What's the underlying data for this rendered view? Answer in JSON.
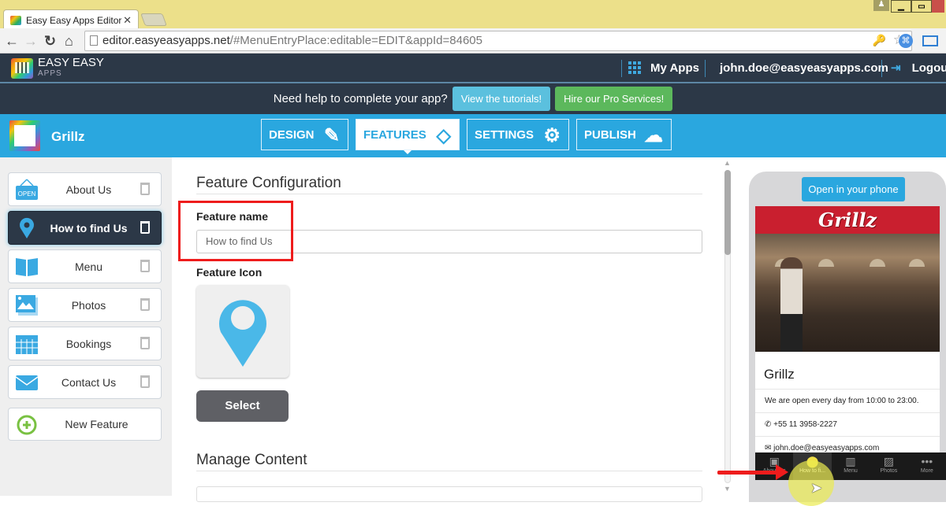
{
  "browser": {
    "tab_title": "Easy Easy Apps Editor",
    "url_host": "editor.easyeasyapps.net",
    "url_path": "/#MenuEntryPlace:editable=EDIT&appId=84605"
  },
  "header": {
    "logo_line1": "EASY EASY",
    "logo_line2": "APPS",
    "my_apps": "My Apps",
    "user_email": "john.doe@easyeasyapps.com",
    "logout": "Logout"
  },
  "help_bar": {
    "text": "Need help to complete your app?",
    "tutorials_button": "View the tutorials!",
    "pro_button": "Hire our Pro Services!",
    "tutorials_color": "#5bc0de",
    "pro_color": "#5cb85c"
  },
  "app": {
    "name": "Grillz"
  },
  "main_tabs": [
    {
      "label": "DESIGN",
      "icon": "brush-icon",
      "glyph": "🖌"
    },
    {
      "label": "FEATURES",
      "icon": "tags-icon",
      "glyph": "◇",
      "active": true
    },
    {
      "label": "SETTINGS",
      "icon": "gear-icon",
      "glyph": "⚙"
    },
    {
      "label": "PUBLISH",
      "icon": "cloud-upload-icon",
      "glyph": "☁"
    }
  ],
  "sidebar": {
    "items": [
      {
        "label": "About Us",
        "icon": "open-sign-icon"
      },
      {
        "label": "How to find Us",
        "icon": "map-pin-icon",
        "active": true
      },
      {
        "label": "Menu",
        "icon": "book-icon"
      },
      {
        "label": "Photos",
        "icon": "photos-icon"
      },
      {
        "label": "Bookings",
        "icon": "calendar-icon"
      },
      {
        "label": "Contact Us",
        "icon": "envelope-icon"
      }
    ],
    "new_feature": "New Feature"
  },
  "config": {
    "title": "Feature Configuration",
    "name_label": "Feature name",
    "name_value": "How to find Us",
    "icon_label": "Feature Icon",
    "select_button": "Select",
    "manage_title": "Manage Content"
  },
  "preview": {
    "open_button": "Open in your phone",
    "banner": "Grillz",
    "title": "Grillz",
    "hours": "We are open every day from 10:00 to 23:00.",
    "phone": "+55 11 3958-2227",
    "email": "john.doe@easyeasyapps.com",
    "tabs": [
      {
        "label": "About Us",
        "glyph": "▣"
      },
      {
        "label": "How to fi...",
        "glyph": "⬤",
        "active": true
      },
      {
        "label": "Menu",
        "glyph": "▥"
      },
      {
        "label": "Photos",
        "glyph": "▨"
      },
      {
        "label": "More",
        "glyph": "•••"
      }
    ]
  }
}
